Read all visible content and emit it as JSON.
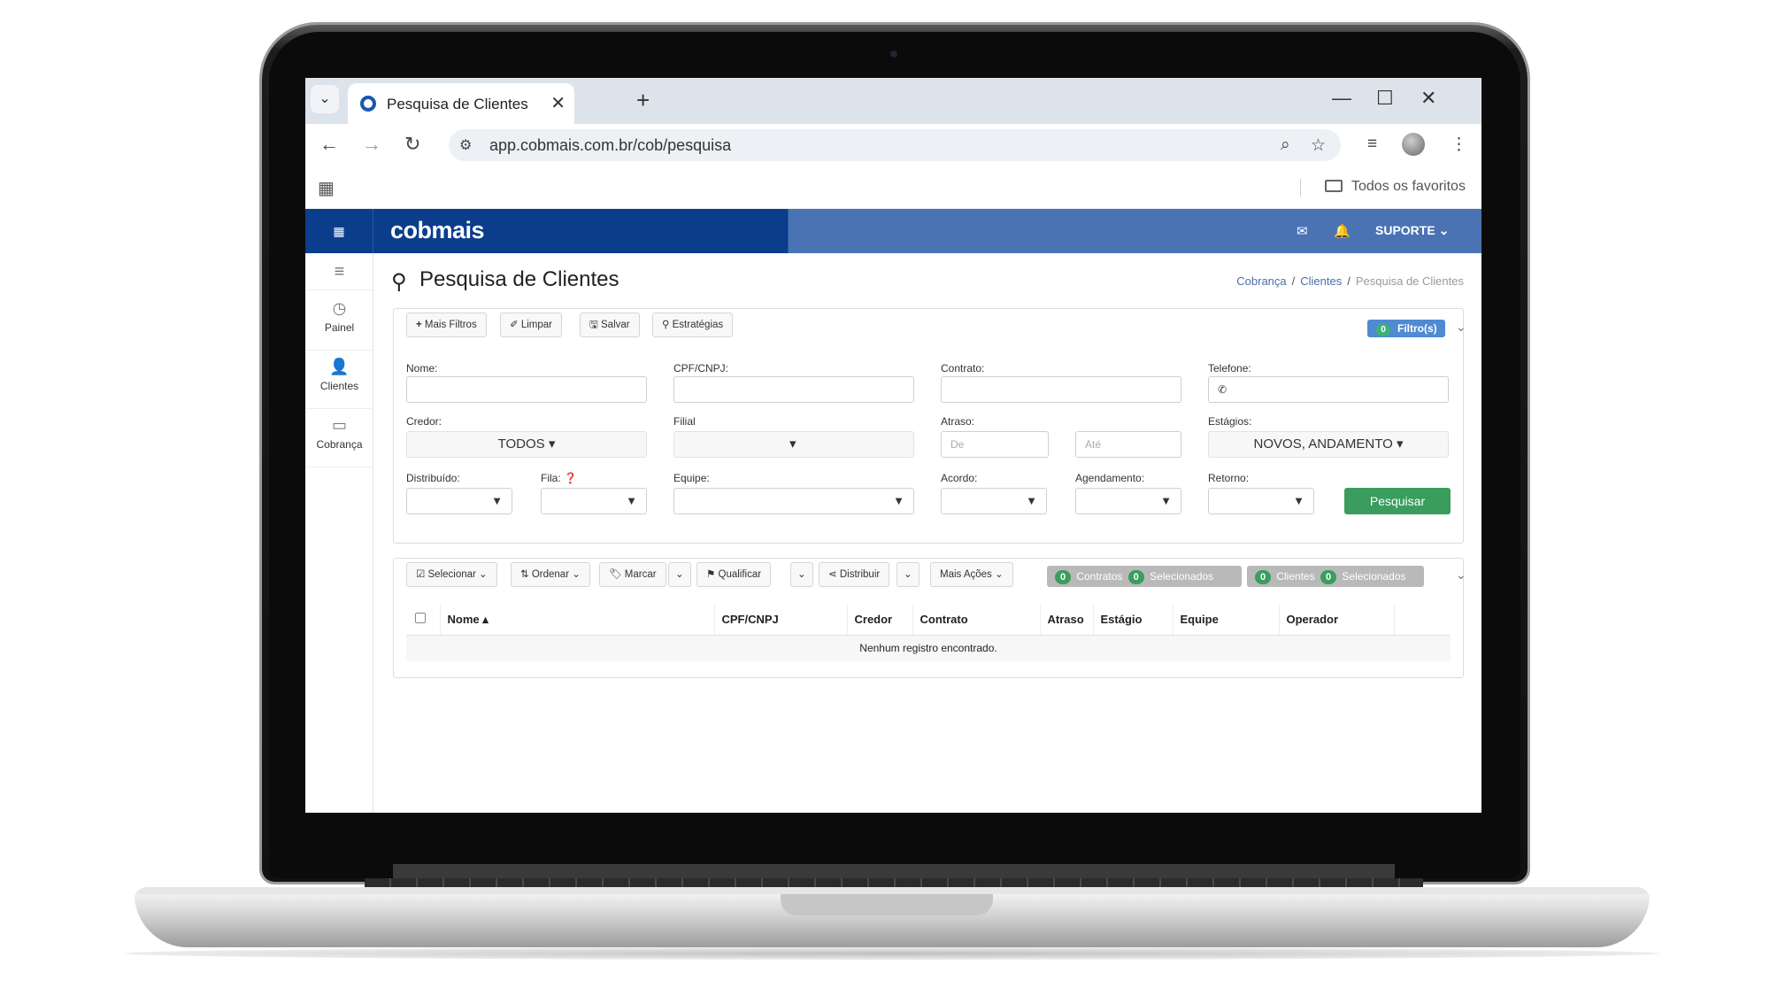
{
  "browser": {
    "tab_title": "Pesquisa de Clientes",
    "url": "app.cobmais.com.br/cob/pesquisa",
    "bookmarks_folder": "Todos os favoritos"
  },
  "header": {
    "logo": "cobmais",
    "user_menu": "SUPORTE"
  },
  "sidebar": {
    "items": [
      {
        "label": "Painel",
        "icon": "clock-icon"
      },
      {
        "label": "Clientes",
        "icon": "user-icon"
      },
      {
        "label": "Cobrança",
        "icon": "monitor-icon"
      }
    ]
  },
  "page": {
    "title": "Pesquisa de Clientes",
    "breadcrumb": [
      "Cobrança",
      "Clientes",
      "Pesquisa de Clientes"
    ]
  },
  "filters": {
    "toolbar": [
      "Mais Filtros",
      "Limpar",
      "Salvar",
      "Estratégias"
    ],
    "filter_badge_count": "0",
    "filter_badge_label": "Filtro(s)",
    "labels": {
      "nome": "Nome:",
      "cpf": "CPF/CNPJ:",
      "contrato": "Contrato:",
      "telefone": "Telefone:",
      "credor": "Credor:",
      "filial": "Filial",
      "atraso": "Atraso:",
      "estagios": "Estágios:",
      "distribuido": "Distribuído:",
      "fila": "Fila:",
      "equipe": "Equipe:",
      "acordo": "Acordo:",
      "agendamento": "Agendamento:",
      "retorno": "Retorno:"
    },
    "credor_value": "TODOS",
    "estagios_value": "NOVOS, ANDAMENTO",
    "atraso_de_placeholder": "De",
    "atraso_ate_placeholder": "Até",
    "search_button": "Pesquisar"
  },
  "results": {
    "toolbar": [
      "Selecionar",
      "Ordenar",
      "Marcar",
      "Qualificar",
      "Distribuir",
      "Mais Ações"
    ],
    "contratos_count": "0",
    "contratos_label": "Contratos",
    "contratos_sel_count": "0",
    "contratos_sel_label": "Selecionados",
    "clientes_count": "0",
    "clientes_label": "Clientes",
    "clientes_sel_count": "0",
    "clientes_sel_label": "Selecionados",
    "columns": [
      "Nome",
      "CPF/CNPJ",
      "Credor",
      "Contrato",
      "Atraso",
      "Estágio",
      "Equipe",
      "Operador"
    ],
    "empty_message": "Nenhum registro encontrado."
  }
}
